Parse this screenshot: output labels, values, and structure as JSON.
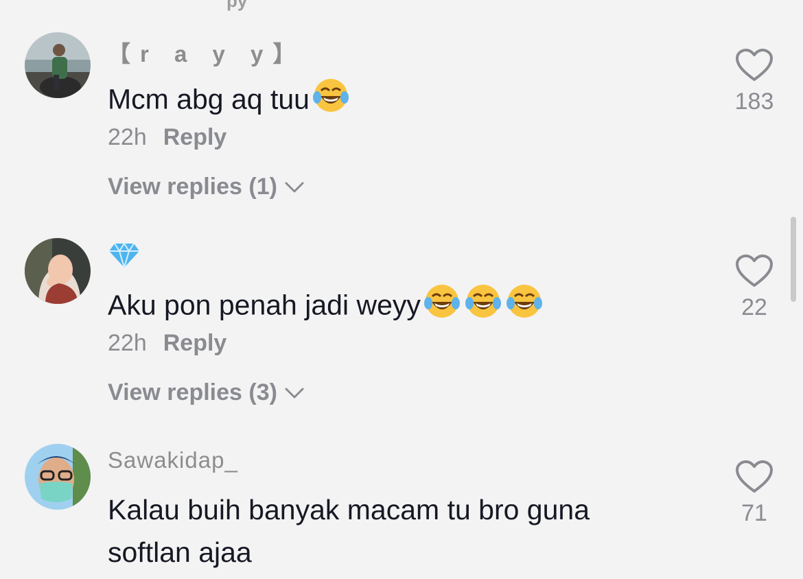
{
  "comments": [
    {
      "username": "【r a y y】",
      "text": "Mcm abg aq tuu",
      "emoji": "😂",
      "emoji_count": 1,
      "time": "22h",
      "reply_label": "Reply",
      "view_replies_label": "View replies (1)",
      "likes": "183"
    },
    {
      "username": "💎",
      "text": "Aku pon penah jadi weyy",
      "emoji": "😂😂😂",
      "emoji_count": 3,
      "time": "22h",
      "reply_label": "Reply",
      "view_replies_label": "View replies (3)",
      "likes": "22"
    },
    {
      "username": "Sawakidap_",
      "text": "Kalau buih banyak macam tu bro guna softlan ajaa",
      "likes": "71"
    }
  ],
  "icons": {
    "like": "heart-outline-icon",
    "expand": "chevron-down-icon",
    "emoji": "face-with-tears-of-joy-icon",
    "username_badge": "gem-icon"
  },
  "colors": {
    "background": "#f3f3f3",
    "primary_text": "#161823",
    "secondary_text": "#8a8b91"
  }
}
